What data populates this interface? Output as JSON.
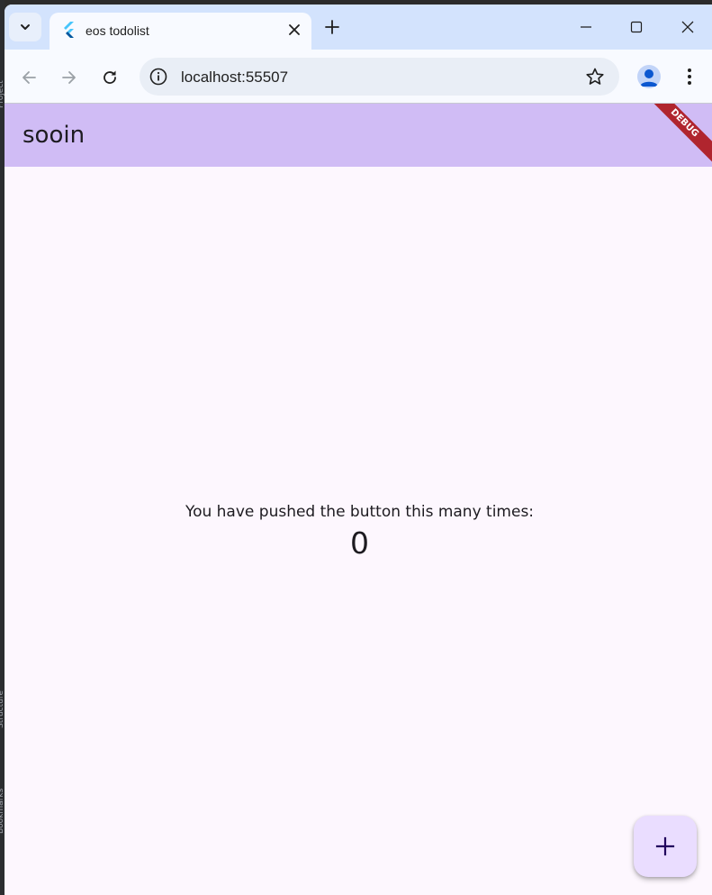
{
  "ide_sidebar": {
    "labels": [
      "Project",
      "Structure",
      "Bookmarks"
    ]
  },
  "browser": {
    "tab": {
      "title": "eos todolist",
      "favicon": "flutter-icon"
    },
    "toolbar": {
      "url": "localhost:55507"
    },
    "colors": {
      "tabstrip": "#d3e3fd",
      "toolbar": "#f8faff",
      "omnibox": "#e9eef6"
    }
  },
  "app": {
    "title": "sooin",
    "debug_banner": "DEBUG",
    "counter_label": "You have pushed the button this many times:",
    "counter_value": "0",
    "fab_icon": "plus-icon",
    "colors": {
      "appbar": "#d0bcf5",
      "background": "#fdf7fe",
      "fab": "#eaddff",
      "debug_banner": "#b0252e"
    }
  }
}
